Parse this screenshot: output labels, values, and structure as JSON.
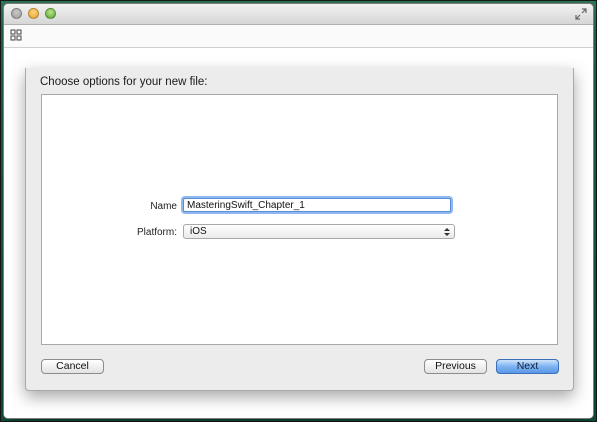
{
  "dialog": {
    "title": "Choose options for your new file:",
    "fields": {
      "name_label": "Name",
      "name_value": "MasteringSwift_Chapter_1",
      "platform_label": "Platform:",
      "platform_value": "iOS"
    },
    "buttons": {
      "cancel": "Cancel",
      "previous": "Previous",
      "next": "Next"
    }
  },
  "icons": {
    "window_close": "close-icon",
    "window_minimize": "minimize-icon",
    "window_zoom": "zoom-icon",
    "fullscreen": "fullscreen-icon",
    "toolbar_grid": "grid-icon",
    "select_arrows": "updown-arrows-icon"
  },
  "colors": {
    "desktop": "#0f5a3e",
    "default_button": "#5a98e6",
    "focus_ring": "#8fb8ee"
  }
}
